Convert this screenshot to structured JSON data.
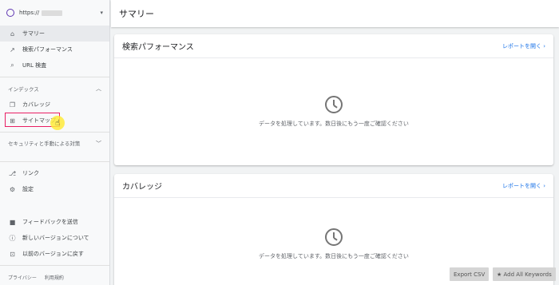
{
  "property": {
    "url_prefix": "https://",
    "caret": "▾"
  },
  "nav_primary": [
    {
      "label": "サマリー",
      "icon": "home-icon",
      "glyph": "⌂",
      "active": true
    },
    {
      "label": "検索パフォーマンス",
      "icon": "trending-icon",
      "glyph": "↗"
    },
    {
      "label": "URL 検査",
      "icon": "search-icon",
      "glyph": "⌕"
    }
  ],
  "index_section": {
    "label": "インデックス",
    "chevron": "︿"
  },
  "nav_index": [
    {
      "label": "カバレッジ",
      "icon": "file-copy-icon",
      "glyph": "❐"
    },
    {
      "label": "サイトマップ",
      "icon": "sitemap-icon",
      "glyph": "⊞"
    }
  ],
  "security_section": {
    "label": "セキュリティと手動による対策",
    "chevron": "﹀"
  },
  "nav_other": [
    {
      "label": "リンク",
      "icon": "links-icon",
      "glyph": "⎇"
    },
    {
      "label": "設定",
      "icon": "settings-icon",
      "glyph": "⚙"
    }
  ],
  "nav_footer": [
    {
      "label": "フィードバックを送信",
      "icon": "feedback-icon",
      "glyph": "■"
    },
    {
      "label": "新しいバージョンについて",
      "icon": "info-icon",
      "glyph": "ⓘ"
    },
    {
      "label": "以前のバージョンに戻す",
      "icon": "exit-icon",
      "glyph": "⊡"
    }
  ],
  "legal": {
    "privacy": "プライバシー",
    "terms": "利用規約"
  },
  "cursor_glyph": "☝",
  "page_title": "サマリー",
  "cards": [
    {
      "title": "検索パフォーマンス",
      "link": "レポートを開く ›",
      "message": "データを処理しています。数日後にもう一度ご確認ください"
    },
    {
      "title": "カバレッジ",
      "link": "レポートを開く ›",
      "message": "データを処理しています。数日後にもう一度ご確認ください"
    }
  ],
  "extension_buttons": {
    "export_csv": "Export CSV",
    "add_keywords": "★ Add All Keywords"
  },
  "colors": {
    "accent": "#1a73e8",
    "highlight_border": "#e91e63",
    "cursor_highlight": "#ffeb3b"
  }
}
